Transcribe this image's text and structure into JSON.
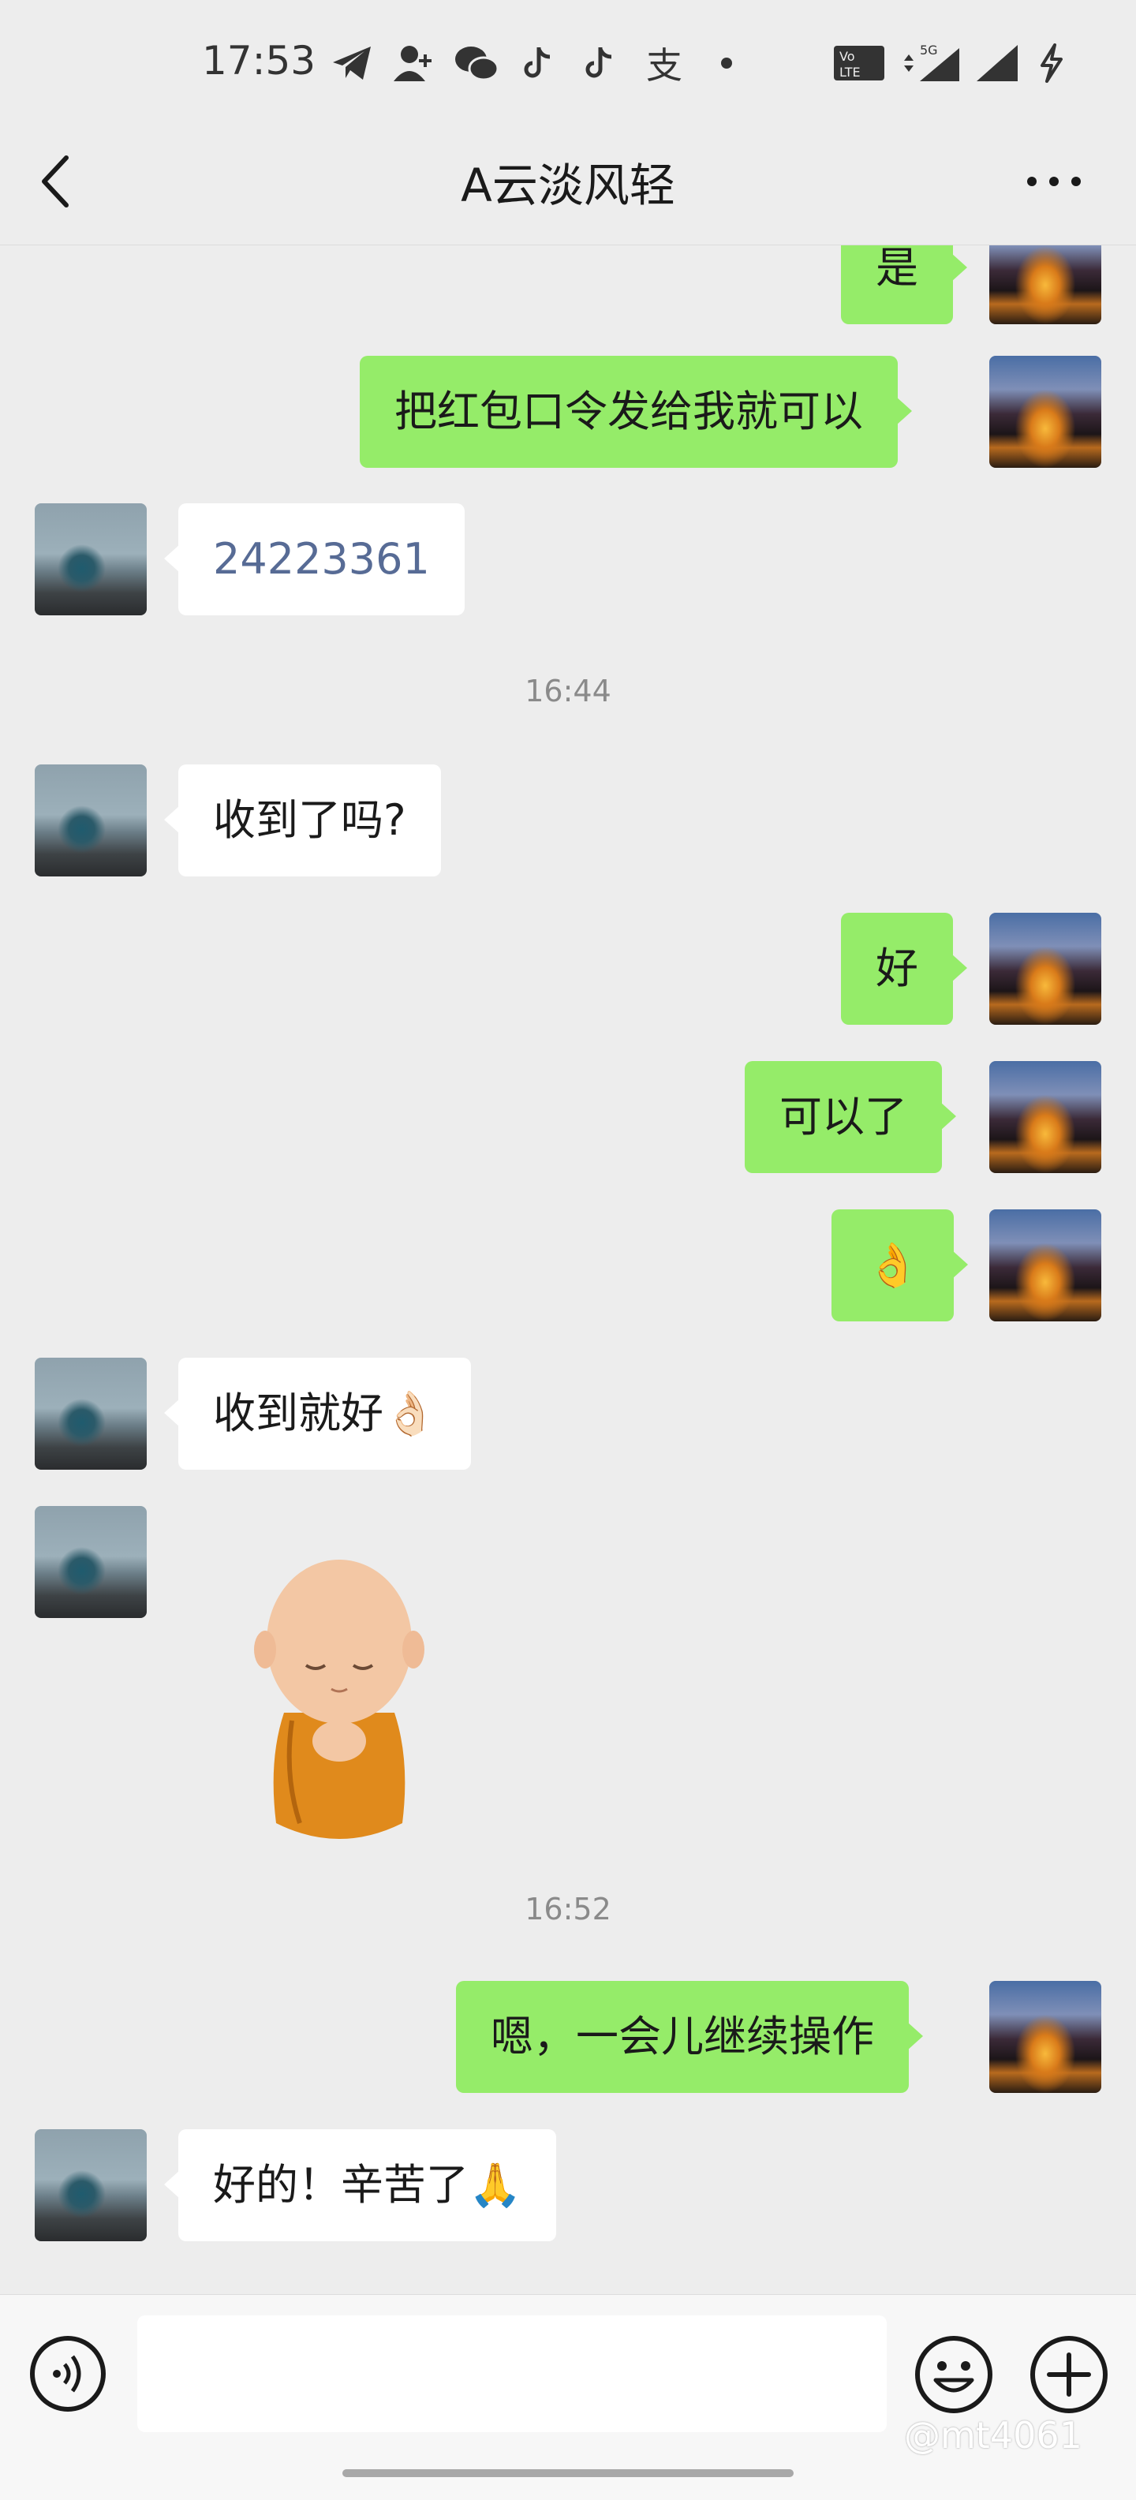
{
  "status_bar": {
    "time": "17:53",
    "network": "5G",
    "volte": "Vo LTE"
  },
  "header": {
    "title": "A云淡风轻"
  },
  "messages": [
    {
      "from": "me",
      "text": "是"
    },
    {
      "from": "me",
      "text": "把红包口令发给我就可以"
    },
    {
      "from": "them",
      "text": "24223361"
    },
    {
      "type": "time",
      "text": "16:44"
    },
    {
      "from": "them",
      "text": "收到了吗?"
    },
    {
      "from": "me",
      "text": "好"
    },
    {
      "from": "me",
      "text": "可以了"
    },
    {
      "from": "me",
      "text": "👌"
    },
    {
      "from": "them",
      "text": "收到就好👌🏻"
    },
    {
      "from": "them",
      "type": "sticker",
      "sticker": "praying-monk"
    },
    {
      "type": "time",
      "text": "16:52"
    },
    {
      "from": "me",
      "text": "嗯，一会儿继续操作"
    },
    {
      "from": "them",
      "text": "好的！辛苦了🙏"
    }
  ],
  "input": {
    "value": "",
    "placeholder": ""
  },
  "watermark": "@mt4061",
  "icons": {
    "back": "chevron-left-icon",
    "more": "ellipsis-icon",
    "voice": "voice-icon",
    "emoji": "smiley-icon",
    "plus": "plus-circle-icon"
  },
  "colors": {
    "my_bubble": "#95ec69",
    "their_bubble": "#ffffff",
    "background": "#ededed",
    "number_link": "#576b95"
  }
}
